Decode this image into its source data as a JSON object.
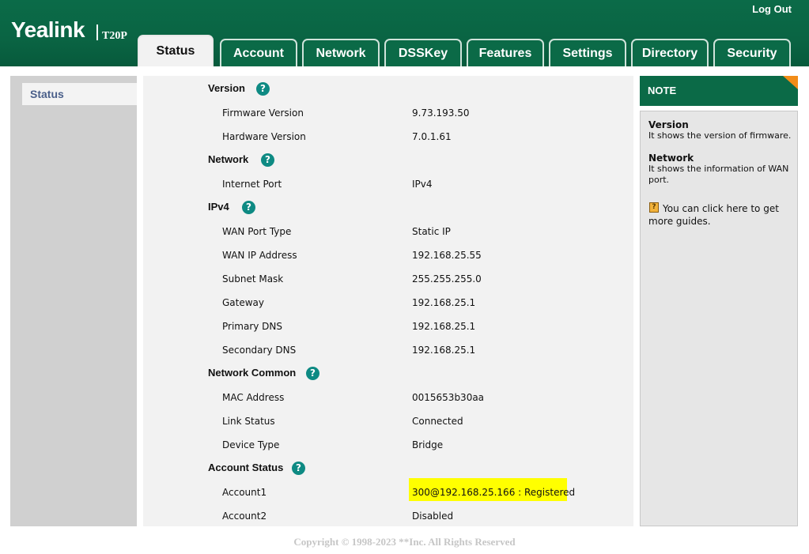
{
  "header": {
    "logo": "Yealink",
    "model": "T20P",
    "logout": "Log Out",
    "tabs": [
      {
        "label": "Status",
        "active": true
      },
      {
        "label": "Account"
      },
      {
        "label": "Network"
      },
      {
        "label": "DSSKey"
      },
      {
        "label": "Features"
      },
      {
        "label": "Settings"
      },
      {
        "label": "Directory"
      },
      {
        "label": "Security"
      }
    ]
  },
  "sidebar": {
    "items": [
      {
        "label": "Status"
      }
    ]
  },
  "help_glyph": "?",
  "sections": {
    "version": {
      "title": "Version",
      "rows": [
        {
          "label": "Firmware Version",
          "value": "9.73.193.50"
        },
        {
          "label": "Hardware Version",
          "value": "7.0.1.61"
        }
      ]
    },
    "network": {
      "title": "Network",
      "rows": [
        {
          "label": "Internet Port",
          "value": "IPv4"
        }
      ]
    },
    "ipv4": {
      "title": "IPv4",
      "rows": [
        {
          "label": "WAN Port Type",
          "value": "Static IP"
        },
        {
          "label": "WAN IP Address",
          "value": "192.168.25.55"
        },
        {
          "label": "Subnet Mask",
          "value": "255.255.255.0"
        },
        {
          "label": "Gateway",
          "value": "192.168.25.1"
        },
        {
          "label": "Primary DNS",
          "value": "192.168.25.1"
        },
        {
          "label": "Secondary DNS",
          "value": "192.168.25.1"
        }
      ]
    },
    "network_common": {
      "title": "Network Common",
      "rows": [
        {
          "label": "MAC Address",
          "value": "0015653b30aa"
        },
        {
          "label": "Link Status",
          "value": "Connected"
        },
        {
          "label": "Device Type",
          "value": "Bridge"
        }
      ]
    },
    "account_status": {
      "title": "Account Status",
      "rows": [
        {
          "label": "Account1",
          "value": "300@192.168.25.166 : Registered"
        },
        {
          "label": "Account2",
          "value": "Disabled"
        }
      ]
    }
  },
  "highlight_color": "#ffff00",
  "note": {
    "title": "NOTE",
    "items": [
      {
        "title": "Version",
        "text": "It shows the version of firmware."
      },
      {
        "title": "Network",
        "text": "It shows the information of WAN port."
      }
    ],
    "guide_icon": "?",
    "guide_text": "You can click here to get more guides."
  },
  "footer": "Copyright © 1998-2023 **Inc. All Rights Reserved",
  "colors": {
    "brand_green": "#0b6a47",
    "help_teal": "#0e8a83",
    "note_corner": "#f28c18"
  }
}
